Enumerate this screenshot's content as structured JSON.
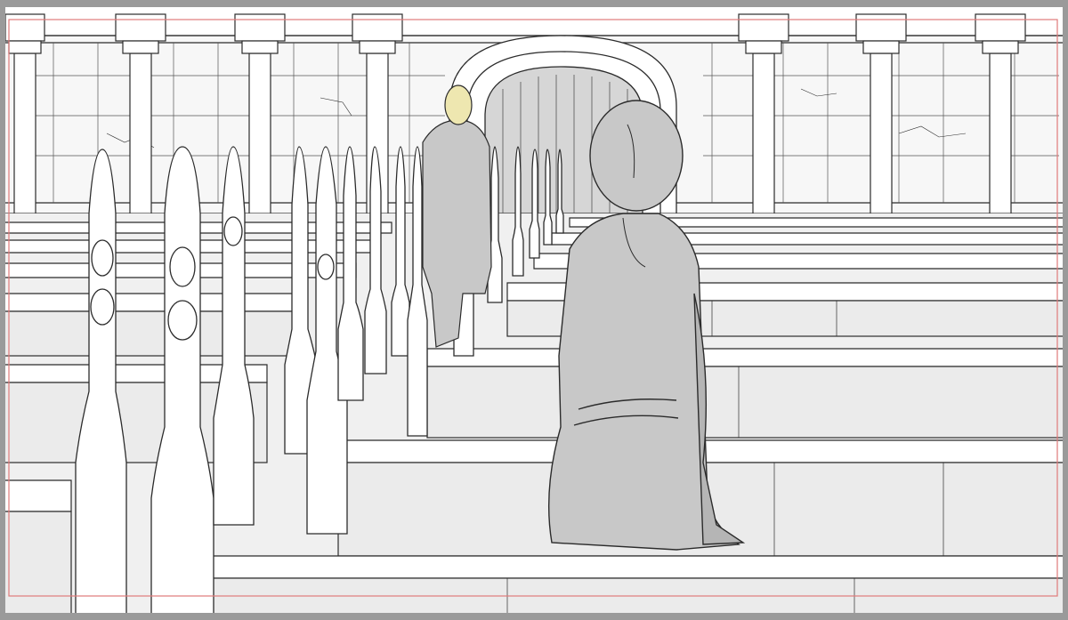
{
  "scene": {
    "palette": {
      "paper": "#ffffff",
      "frame_gray": "#9a9a9a",
      "line": "#2b2b2b",
      "shade": "#e6e6e6",
      "figure_gray": "#c8c8c8",
      "figure_dark": "#b5b5b5",
      "hair_blonde": "#eee7b0",
      "safe_frame_red": "#e07a7a"
    }
  }
}
